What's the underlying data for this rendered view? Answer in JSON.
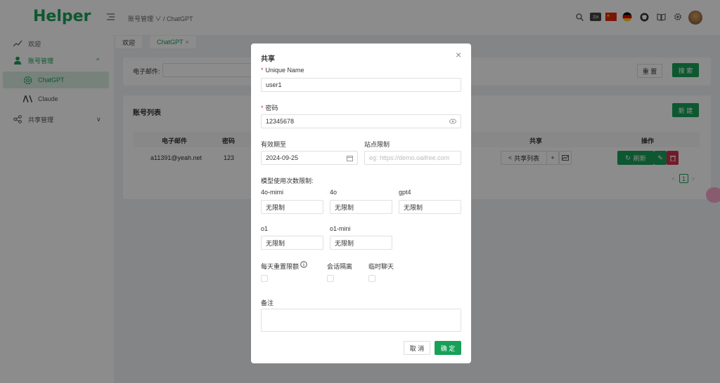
{
  "app": {
    "logo": "Helper"
  },
  "header": {
    "breadcrumb": "账号管理 ∨ / ChatGPT",
    "lang_badge": "文A"
  },
  "sidebar": {
    "items": [
      {
        "label": "欢迎"
      },
      {
        "label": "账号管理",
        "chevron": "^"
      },
      {
        "label": "ChatGPT"
      },
      {
        "label": "Claude"
      },
      {
        "label": "共享管理",
        "chevron": "∨"
      }
    ]
  },
  "tabs": [
    {
      "label": "欢迎"
    },
    {
      "label": "ChatGPT",
      "close": "×"
    }
  ],
  "search": {
    "email_label": "电子邮件:",
    "reset_label": "重 置",
    "search_label": "搜 索"
  },
  "list": {
    "title": "账号列表",
    "new_label": "新 建",
    "columns": [
      "电子邮件",
      "密码",
      "共享",
      "操作"
    ],
    "rows": [
      {
        "email": "a11391@yeah.net",
        "password": "123",
        "share_label": "共享列表",
        "refresh_label": "刷新"
      }
    ],
    "pagination": {
      "prev": "<",
      "page": "1",
      "next": ">"
    }
  },
  "modal": {
    "title": "共享",
    "close": "×",
    "unique_name_label": "Unique Name",
    "unique_name_value": "user1",
    "password_label": "密码",
    "password_value": "12345678",
    "expiry_label": "有效期至",
    "expiry_value": "2024-09-25",
    "site_limit_label": "站点限制",
    "site_limit_placeholder": "eg: https://demo.oaifree.com",
    "usage_label": "模型使用次数限制:",
    "models": [
      {
        "name": "4o-mimi",
        "value": "无限制"
      },
      {
        "name": "4o",
        "value": "无限制"
      },
      {
        "name": "gpt4",
        "value": "无限制"
      },
      {
        "name": "o1",
        "value": "无限制"
      },
      {
        "name": "o1-mini",
        "value": "无限制"
      }
    ],
    "daily_reset_label": "每天重置限额",
    "session_isolation_label": "会话隔离",
    "temp_chat_label": "临时聊天",
    "note_label": "备注",
    "cancel_label": "取 消",
    "confirm_label": "确 定"
  },
  "colors": {
    "primary": "#18a058",
    "danger": "#d03050"
  }
}
